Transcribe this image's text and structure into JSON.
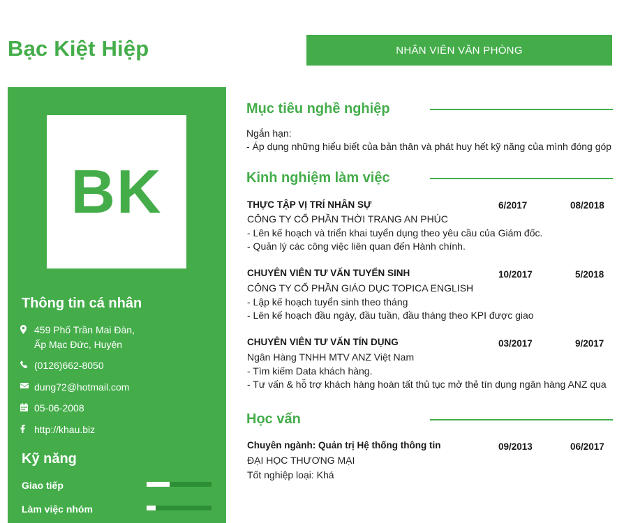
{
  "header": {
    "name": "Bạc Kiệt Hiệp",
    "position": "NHÂN VIÊN VĂN PHÒNG"
  },
  "avatar": {
    "initials": "BK"
  },
  "personal": {
    "title": "Thông tin cá nhân",
    "address_line1": "459 Phố Trần Mai Đàn,",
    "address_line2": "Ấp Mạc Đức, Huyện",
    "phone": "(0126)662-8050",
    "email": "dung72@hotmail.com",
    "birthday": "05-06-2008",
    "website": "http://khau.biz",
    "icons": [
      "map-marker-icon",
      "phone-icon",
      "envelope-icon",
      "calendar-icon",
      "facebook-icon"
    ]
  },
  "skills": {
    "title": "Kỹ năng",
    "items": [
      {
        "label": "Giao tiếp",
        "level": 0.35
      },
      {
        "label": "Làm việc nhóm",
        "level": 0.14
      }
    ]
  },
  "objective": {
    "title": "Mục tiêu nghề nghiệp",
    "line1": "Ngắn hạn:",
    "line2": "- Áp dụng những hiểu biết của bản thân và phát huy hết kỹ năng của mình đóng góp"
  },
  "experience": {
    "title": "Kinh nghiệm làm việc",
    "items": [
      {
        "role": "THỰC TẬP VỊ TRÍ NHÂN SỰ",
        "start": "6/2017",
        "end": "08/2018",
        "company": "CÔNG TY CỔ PHẦN THỜI TRANG AN PHÚC",
        "desc1": "- Lên kế hoạch và triển khai tuyển dụng theo yêu cầu của Giám đốc.",
        "desc2": "- Quản lý các công việc liên quan đến Hành chính."
      },
      {
        "role": "CHUYÊN VIÊN TƯ VẤN TUYỂN SINH",
        "start": "10/2017",
        "end": "5/2018",
        "company": "CÔNG TY CỔ PHẦN GIÁO DỤC TOPICA ENGLISH",
        "desc1": "- Lập kế hoạch tuyển sinh theo tháng",
        "desc2": "- Lên kế hoạch đầu ngày, đầu tuần, đầu tháng theo KPI được giao"
      },
      {
        "role": "CHUYÊN VIÊN TƯ VẤN TÍN DỤNG",
        "start": "03/2017",
        "end": "9/2017",
        "company": "Ngân Hàng TNHH MTV ANZ Việt Nam",
        "desc1": "- Tìm kiếm Data khách hàng.",
        "desc2": "- Tư vấn & hỗ trợ khách hàng hoàn tất thủ tục mở thẻ tín dụng ngân hàng ANZ qua"
      }
    ]
  },
  "education": {
    "title": "Học vấn",
    "major": "Chuyên ngành: Quản trị Hệ thống thông tin",
    "start": "09/2013",
    "end": "06/2017",
    "school": "ĐẠI HỌC THƯƠNG MẠI",
    "grade": "Tốt nghiệp loại: Khá"
  },
  "colors": {
    "accent": "#44ad4a",
    "bar_track": "#2e8e35"
  }
}
